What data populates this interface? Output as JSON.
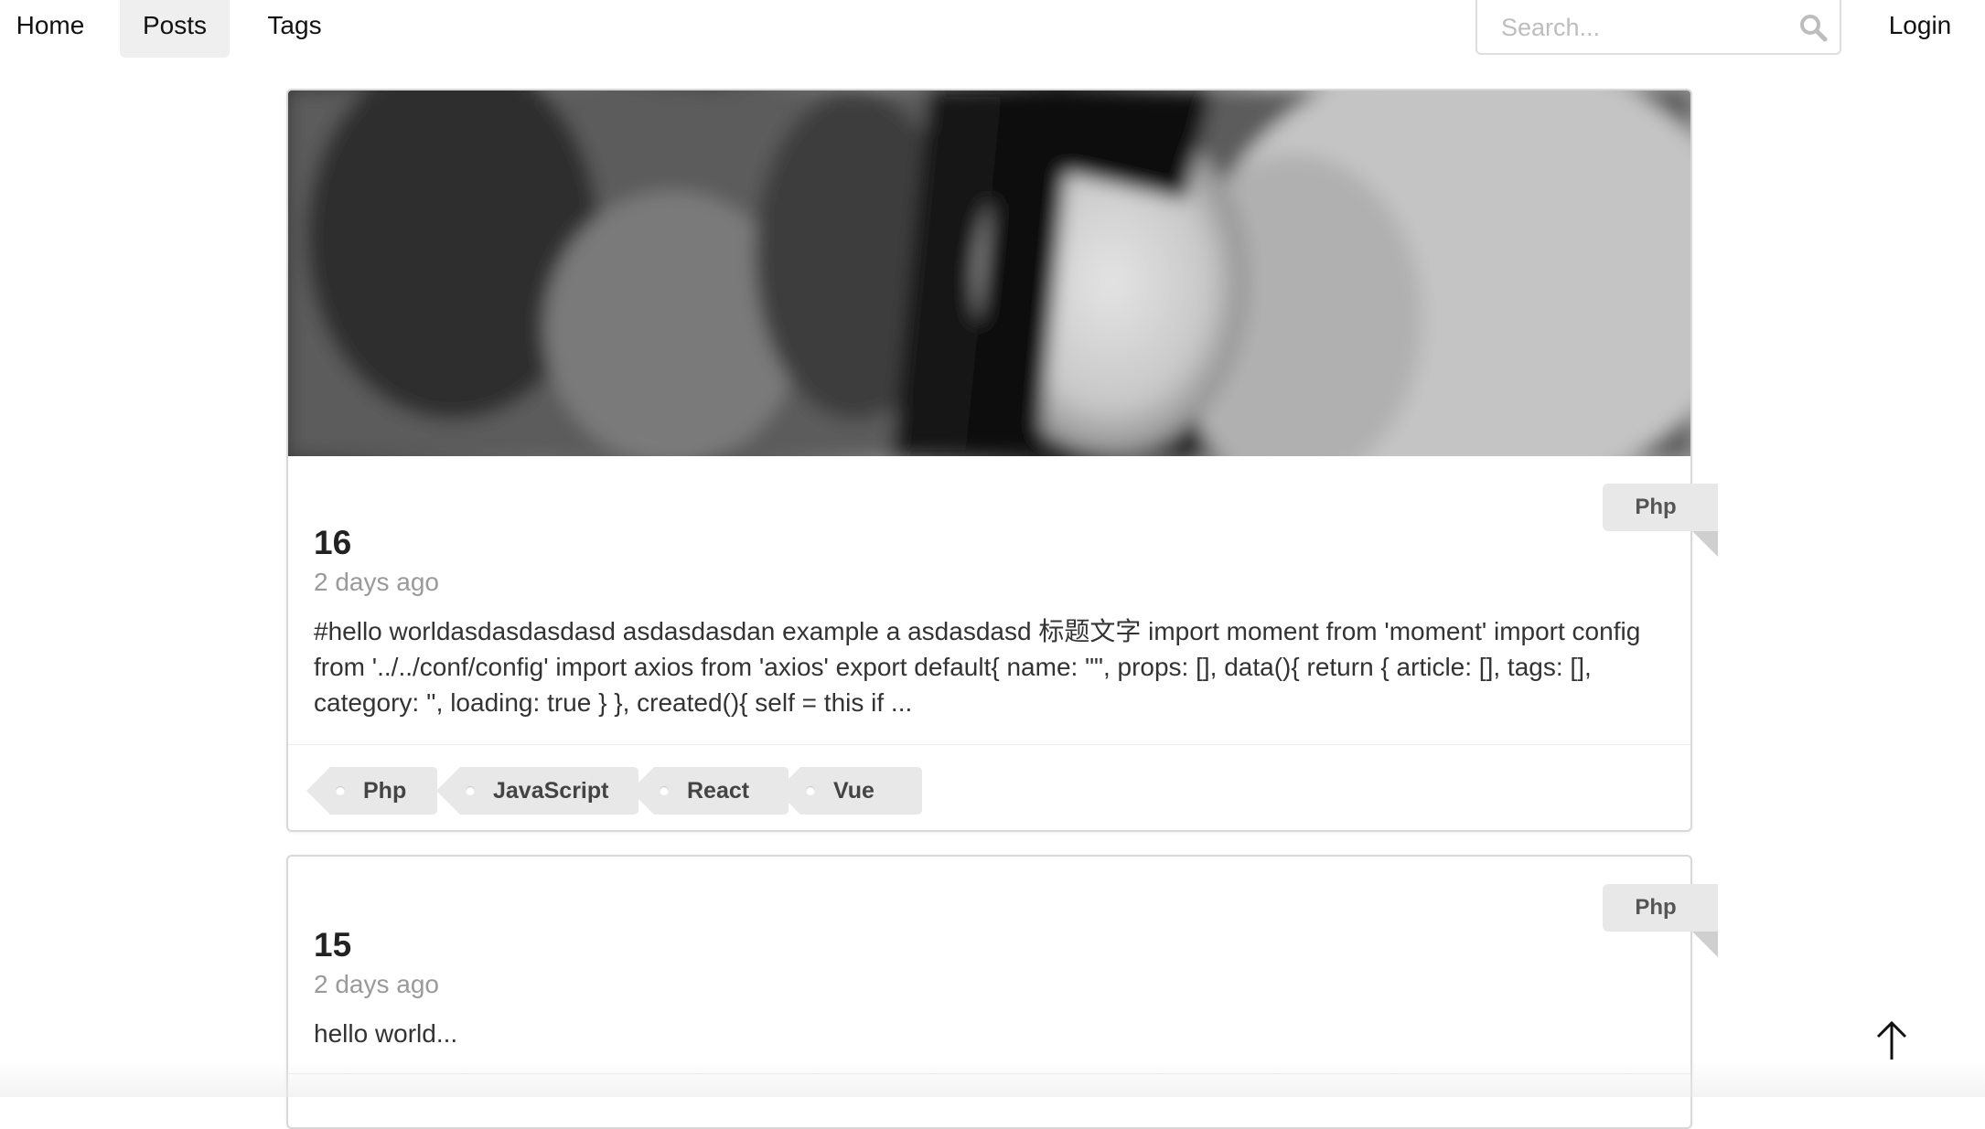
{
  "nav": {
    "home": "Home",
    "posts": "Posts",
    "tags": "Tags",
    "search_placeholder": "Search...",
    "login": "Login",
    "active": "Posts"
  },
  "posts": [
    {
      "category": "Php",
      "title": "16",
      "date": "2 days ago",
      "excerpt": "#hello worldasdasdasdasd asdasdasdan example a asdasdasd  标题文字   import moment from 'moment' import config from '../../conf/config' import axios from 'axios' export default{ name: \"\", props: [], data(){ return { article: [], tags: [], category: '', loading: true } }, created(){ self = this  if ...",
      "tags": [
        "Php",
        "JavaScript",
        "React",
        "Vue"
      ],
      "has_image": true
    },
    {
      "category": "Php",
      "title": "15",
      "date": "2 days ago",
      "excerpt": "hello world...",
      "has_image": false
    }
  ],
  "icons": {
    "search": "search-icon",
    "back_to_top": "arrow-up-icon",
    "tag_hole": "tag-hole-icon"
  },
  "colors": {
    "nav_active_bg": "#efefef",
    "tag_bg": "#e8e8e8",
    "date_text": "#9a9a9a",
    "card_border": "#d8d8d8"
  }
}
